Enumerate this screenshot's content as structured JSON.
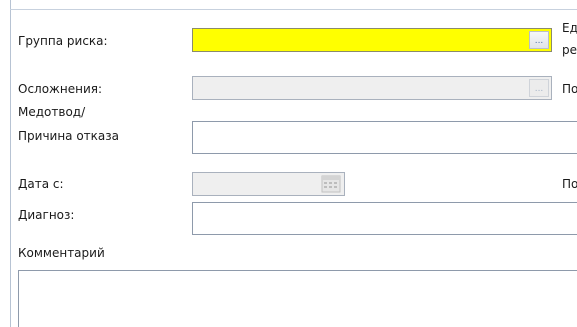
{
  "form": {
    "risk_group_label": "Группа риска:",
    "complications_label": "Осложнения:",
    "exemption_label_line1": "Медотвод/",
    "exemption_label_line2": "Причина отказа",
    "date_from_label": "Дата с:",
    "diagnosis_label": "Диагноз:",
    "comment_label": "Комментарий",
    "risk_group_value": "",
    "complications_value": "",
    "exemption_value": "",
    "date_from_value": "",
    "diagnosis_value": "",
    "comment_value": "",
    "ellipsis_glyph": "...",
    "right_fragments": {
      "row1_top": "Ед",
      "row1_bottom": "ре",
      "row2": "По",
      "row4": "По"
    }
  },
  "colors": {
    "risk_field_bg": "#ffff00",
    "disabled_field_bg": "#efefef"
  },
  "icons": {
    "ellipsis": "ellipsis-icon",
    "calendar": "calendar-icon"
  }
}
